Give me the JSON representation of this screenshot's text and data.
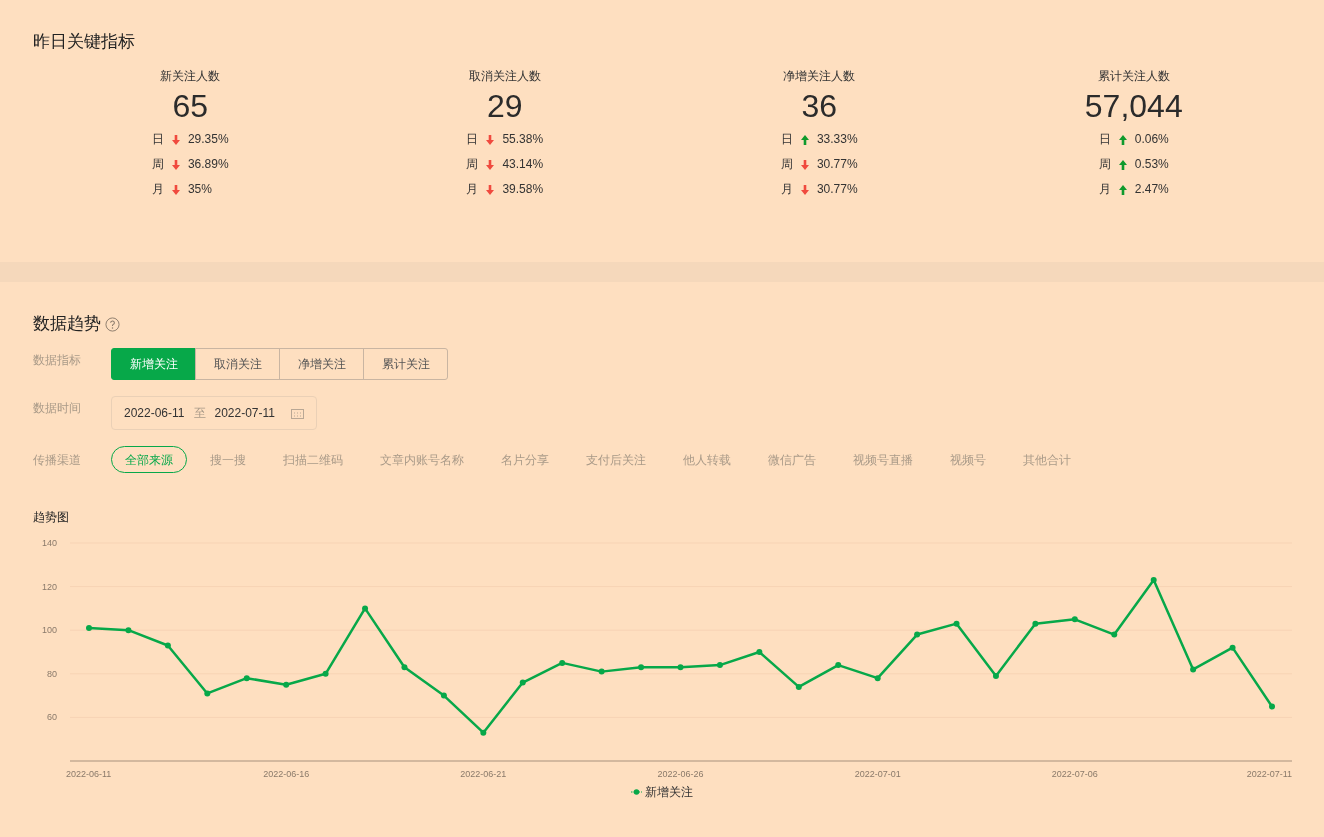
{
  "key_metrics": {
    "title": "昨日关键指标",
    "metrics": [
      {
        "label": "新关注人数",
        "value": "65",
        "changes": [
          {
            "period": "日",
            "kind": "down",
            "percent": "29.35%"
          },
          {
            "period": "周",
            "kind": "down",
            "percent": "36.89%"
          },
          {
            "period": "月",
            "kind": "down",
            "percent": "35%"
          }
        ]
      },
      {
        "label": "取消关注人数",
        "value": "29",
        "changes": [
          {
            "period": "日",
            "kind": "down",
            "percent": "55.38%"
          },
          {
            "period": "周",
            "kind": "down",
            "percent": "43.14%"
          },
          {
            "period": "月",
            "kind": "down",
            "percent": "39.58%"
          }
        ]
      },
      {
        "label": "净增关注人数",
        "value": "36",
        "changes": [
          {
            "period": "日",
            "kind": "up",
            "percent": "33.33%"
          },
          {
            "period": "周",
            "kind": "down",
            "percent": "30.77%"
          },
          {
            "period": "月",
            "kind": "down",
            "percent": "30.77%"
          }
        ]
      },
      {
        "label": "累计关注人数",
        "value": "57,044",
        "changes": [
          {
            "period": "日",
            "kind": "up",
            "percent": "0.06%"
          },
          {
            "period": "周",
            "kind": "up",
            "percent": "0.53%"
          },
          {
            "period": "月",
            "kind": "up",
            "percent": "2.47%"
          }
        ]
      }
    ]
  },
  "trend": {
    "title": "数据趋势",
    "indicator": {
      "label": "数据指标",
      "options": [
        {
          "label": "新增关注",
          "selected": true
        },
        {
          "label": "取消关注",
          "selected": false
        },
        {
          "label": "净增关注",
          "selected": false
        },
        {
          "label": "累计关注",
          "selected": false
        }
      ]
    },
    "time": {
      "label": "数据时间",
      "start": "2022-06-11",
      "separator": "至",
      "end": "2022-07-11"
    },
    "channel": {
      "label": "传播渠道",
      "options": [
        {
          "label": "全部来源",
          "selected": true
        },
        {
          "label": "搜一搜",
          "selected": false
        },
        {
          "label": "扫描二维码",
          "selected": false
        },
        {
          "label": "文章内账号名称",
          "selected": false
        },
        {
          "label": "名片分享",
          "selected": false
        },
        {
          "label": "支付后关注",
          "selected": false
        },
        {
          "label": "他人转载",
          "selected": false
        },
        {
          "label": "微信广告",
          "selected": false
        },
        {
          "label": "视频号直播",
          "selected": false
        },
        {
          "label": "视频号",
          "selected": false
        },
        {
          "label": "其他合计",
          "selected": false
        }
      ]
    },
    "chart_title": "趋势图",
    "chart_data": {
      "type": "line",
      "categories": [
        "2022-06-11",
        null,
        null,
        null,
        null,
        "2022-06-16",
        null,
        null,
        null,
        null,
        "2022-06-21",
        null,
        null,
        null,
        null,
        "2022-06-26",
        null,
        null,
        null,
        null,
        "2022-07-01",
        null,
        null,
        null,
        null,
        "2022-07-06",
        null,
        null,
        null,
        null,
        "2022-07-11"
      ],
      "grid": true,
      "ylim": [
        40,
        140
      ],
      "yticks": [
        60,
        80,
        100,
        120,
        140
      ],
      "series": [
        {
          "name": "新增关注",
          "color": "#07a849",
          "marker": "circle",
          "values": [
            101,
            100,
            93,
            71,
            78,
            75,
            80,
            110,
            83,
            70,
            53,
            76,
            85,
            81,
            83,
            83,
            84,
            90,
            74,
            84,
            78,
            98,
            103,
            79,
            103,
            105,
            98,
            123,
            82,
            92,
            65
          ]
        }
      ]
    }
  }
}
